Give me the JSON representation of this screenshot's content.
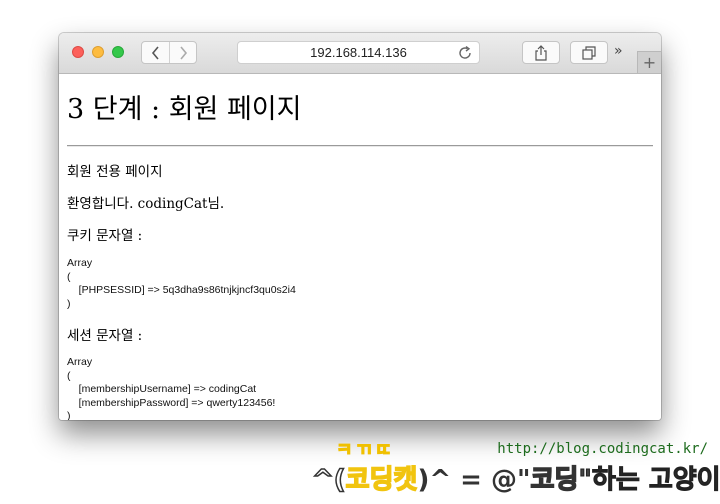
{
  "browser": {
    "url": "192.168.114.136",
    "overflow_glyph": "»",
    "new_tab_glyph": "+"
  },
  "page": {
    "title": "3 단계 : 회원 페이지",
    "line1": "회원 전용 페이지",
    "line2": "환영합니다. codingCat님.",
    "cookie_heading": "쿠키 문자열 :",
    "cookie_array": "Array\n(\n    [PHPSESSID] => 5q3dha9s86tnjkjncf3qu0s2i4\n)",
    "session_heading": "세션 문자열 :",
    "session_array": "Array\n(\n    [membershipUsername] => codingCat\n    [membershipPassword] => qwerty123456!\n)"
  },
  "watermark": {
    "url": "http://blog.codingcat.kr/",
    "top_text": "ㅋㄲㄸ",
    "part1": "^(",
    "part2": "코딩캣",
    "part3": ")^ = @\"",
    "part4": "코딩",
    "part5": "\"하는 고양이;"
  },
  "icons": [
    "back-icon",
    "forward-icon",
    "reload-icon",
    "share-icon",
    "tabs-icon",
    "overflow-icon",
    "new-tab-icon"
  ],
  "colors": {
    "close": "#fc605b",
    "minimize": "#fdbc40",
    "zoom": "#34c84a"
  }
}
